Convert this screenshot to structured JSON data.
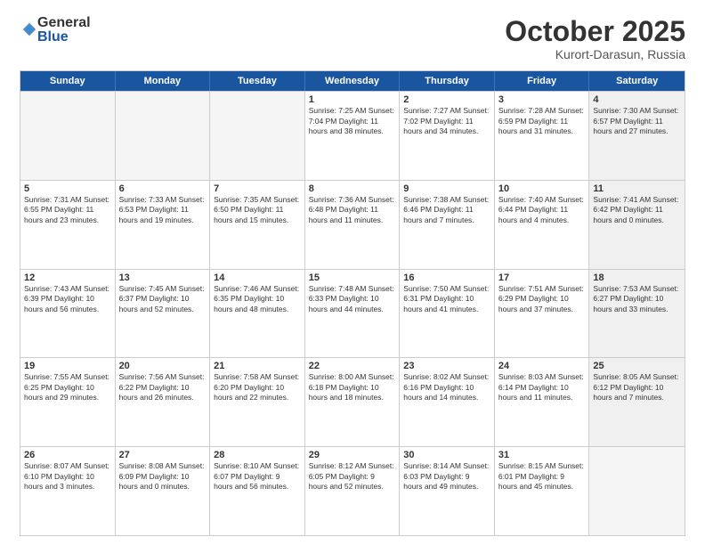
{
  "logo": {
    "general": "General",
    "blue": "Blue"
  },
  "title": "October 2025",
  "location": "Kurort-Darasun, Russia",
  "weekdays": [
    "Sunday",
    "Monday",
    "Tuesday",
    "Wednesday",
    "Thursday",
    "Friday",
    "Saturday"
  ],
  "rows": [
    [
      {
        "day": "",
        "info": "",
        "empty": true
      },
      {
        "day": "",
        "info": "",
        "empty": true
      },
      {
        "day": "",
        "info": "",
        "empty": true
      },
      {
        "day": "1",
        "info": "Sunrise: 7:25 AM\nSunset: 7:04 PM\nDaylight: 11 hours\nand 38 minutes."
      },
      {
        "day": "2",
        "info": "Sunrise: 7:27 AM\nSunset: 7:02 PM\nDaylight: 11 hours\nand 34 minutes."
      },
      {
        "day": "3",
        "info": "Sunrise: 7:28 AM\nSunset: 6:59 PM\nDaylight: 11 hours\nand 31 minutes."
      },
      {
        "day": "4",
        "info": "Sunrise: 7:30 AM\nSunset: 6:57 PM\nDaylight: 11 hours\nand 27 minutes.",
        "shaded": true
      }
    ],
    [
      {
        "day": "5",
        "info": "Sunrise: 7:31 AM\nSunset: 6:55 PM\nDaylight: 11 hours\nand 23 minutes."
      },
      {
        "day": "6",
        "info": "Sunrise: 7:33 AM\nSunset: 6:53 PM\nDaylight: 11 hours\nand 19 minutes."
      },
      {
        "day": "7",
        "info": "Sunrise: 7:35 AM\nSunset: 6:50 PM\nDaylight: 11 hours\nand 15 minutes."
      },
      {
        "day": "8",
        "info": "Sunrise: 7:36 AM\nSunset: 6:48 PM\nDaylight: 11 hours\nand 11 minutes."
      },
      {
        "day": "9",
        "info": "Sunrise: 7:38 AM\nSunset: 6:46 PM\nDaylight: 11 hours\nand 7 minutes."
      },
      {
        "day": "10",
        "info": "Sunrise: 7:40 AM\nSunset: 6:44 PM\nDaylight: 11 hours\nand 4 minutes."
      },
      {
        "day": "11",
        "info": "Sunrise: 7:41 AM\nSunset: 6:42 PM\nDaylight: 11 hours\nand 0 minutes.",
        "shaded": true
      }
    ],
    [
      {
        "day": "12",
        "info": "Sunrise: 7:43 AM\nSunset: 6:39 PM\nDaylight: 10 hours\nand 56 minutes."
      },
      {
        "day": "13",
        "info": "Sunrise: 7:45 AM\nSunset: 6:37 PM\nDaylight: 10 hours\nand 52 minutes."
      },
      {
        "day": "14",
        "info": "Sunrise: 7:46 AM\nSunset: 6:35 PM\nDaylight: 10 hours\nand 48 minutes."
      },
      {
        "day": "15",
        "info": "Sunrise: 7:48 AM\nSunset: 6:33 PM\nDaylight: 10 hours\nand 44 minutes."
      },
      {
        "day": "16",
        "info": "Sunrise: 7:50 AM\nSunset: 6:31 PM\nDaylight: 10 hours\nand 41 minutes."
      },
      {
        "day": "17",
        "info": "Sunrise: 7:51 AM\nSunset: 6:29 PM\nDaylight: 10 hours\nand 37 minutes."
      },
      {
        "day": "18",
        "info": "Sunrise: 7:53 AM\nSunset: 6:27 PM\nDaylight: 10 hours\nand 33 minutes.",
        "shaded": true
      }
    ],
    [
      {
        "day": "19",
        "info": "Sunrise: 7:55 AM\nSunset: 6:25 PM\nDaylight: 10 hours\nand 29 minutes."
      },
      {
        "day": "20",
        "info": "Sunrise: 7:56 AM\nSunset: 6:22 PM\nDaylight: 10 hours\nand 26 minutes."
      },
      {
        "day": "21",
        "info": "Sunrise: 7:58 AM\nSunset: 6:20 PM\nDaylight: 10 hours\nand 22 minutes."
      },
      {
        "day": "22",
        "info": "Sunrise: 8:00 AM\nSunset: 6:18 PM\nDaylight: 10 hours\nand 18 minutes."
      },
      {
        "day": "23",
        "info": "Sunrise: 8:02 AM\nSunset: 6:16 PM\nDaylight: 10 hours\nand 14 minutes."
      },
      {
        "day": "24",
        "info": "Sunrise: 8:03 AM\nSunset: 6:14 PM\nDaylight: 10 hours\nand 11 minutes."
      },
      {
        "day": "25",
        "info": "Sunrise: 8:05 AM\nSunset: 6:12 PM\nDaylight: 10 hours\nand 7 minutes.",
        "shaded": true
      }
    ],
    [
      {
        "day": "26",
        "info": "Sunrise: 8:07 AM\nSunset: 6:10 PM\nDaylight: 10 hours\nand 3 minutes."
      },
      {
        "day": "27",
        "info": "Sunrise: 8:08 AM\nSunset: 6:09 PM\nDaylight: 10 hours\nand 0 minutes."
      },
      {
        "day": "28",
        "info": "Sunrise: 8:10 AM\nSunset: 6:07 PM\nDaylight: 9 hours\nand 56 minutes."
      },
      {
        "day": "29",
        "info": "Sunrise: 8:12 AM\nSunset: 6:05 PM\nDaylight: 9 hours\nand 52 minutes."
      },
      {
        "day": "30",
        "info": "Sunrise: 8:14 AM\nSunset: 6:03 PM\nDaylight: 9 hours\nand 49 minutes."
      },
      {
        "day": "31",
        "info": "Sunrise: 8:15 AM\nSunset: 6:01 PM\nDaylight: 9 hours\nand 45 minutes."
      },
      {
        "day": "",
        "info": "",
        "empty": true,
        "shaded": true
      }
    ]
  ]
}
